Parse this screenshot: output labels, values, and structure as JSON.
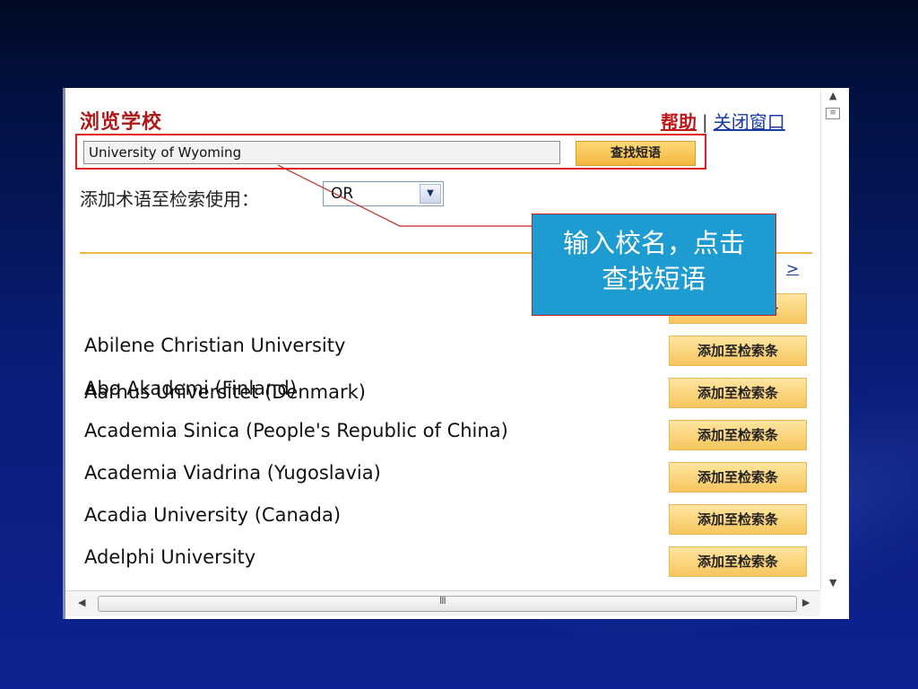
{
  "panel": {
    "title": "浏览学校",
    "help_link": "帮助",
    "separator": "|",
    "close_link": "关闭窗口"
  },
  "search": {
    "value": "University of Wyoming",
    "button_label": "查找短语"
  },
  "operator": {
    "label": "添加术语至检索使用：",
    "selected": "OR"
  },
  "pager": {
    "label": ">"
  },
  "schools": {
    "add_button_label": "添加至检索条",
    "items": [
      "Aarhus Universitet (Denmark)",
      "Abilene Christian University",
      "Abo Akademi (Finland)",
      "Academia Sinica (People's Republic of China)",
      "Academia Viadrina (Yugoslavia)",
      "Acadia University (Canada)",
      "Adelphi University"
    ]
  },
  "scrollbar": {
    "grip": "III"
  },
  "callout": {
    "line1": "输入校名，点击",
    "line2": "查找短语"
  },
  "colors": {
    "title_red": "#b01818",
    "link_blue": "#1a3aa8",
    "button_orange": "#f4b63c",
    "callout_blue": "#1e9cd2",
    "highlight_red": "#e02020"
  }
}
